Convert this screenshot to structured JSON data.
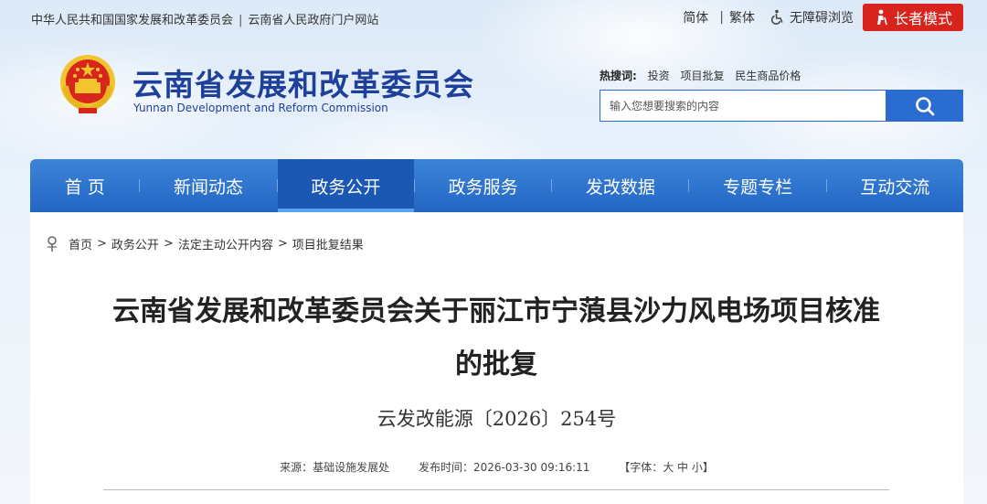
{
  "topbar": {
    "link1": "中华人民共和国国家发展和改革委员会",
    "link2": "云南省人民政府门户网站",
    "separator": "|",
    "simplified": "简体",
    "traditional": "繁体",
    "accessibility": "无障碍浏览",
    "elder_mode": "长者模式"
  },
  "brand": {
    "title": "云南省发展和改革委员会",
    "subtitle": "Yunnan Development and Reform Commission"
  },
  "hot_search": {
    "label": "热搜词:",
    "items": [
      "投资",
      "项目批复",
      "民生商品价格"
    ]
  },
  "search": {
    "placeholder": "输入您想要搜索的内容"
  },
  "nav": {
    "items": [
      {
        "label": "首 页"
      },
      {
        "label": "新闻动态"
      },
      {
        "label": "政务公开"
      },
      {
        "label": "政务服务"
      },
      {
        "label": "发改数据"
      },
      {
        "label": "专题专栏"
      },
      {
        "label": "互动交流"
      }
    ],
    "active_index": 2
  },
  "breadcrumb": {
    "items": [
      "首页",
      "政务公开",
      "法定主动公开内容",
      "项目批复结果"
    ],
    "separator": ">"
  },
  "article": {
    "title_line1": "云南省发展和改革委员会关于丽江市宁蒗县沙力风电场项目核准",
    "title_line2": "的批复",
    "doc_number": "云发改能源〔2026〕254号",
    "source": "来源：基础设施发展处",
    "publish_time": "发布时间：2026-03-30 09:16:11",
    "font_size_control": "【字体：大 中 小】"
  },
  "colors": {
    "brand_blue": "#1e3f9a",
    "nav_blue": "#2a6ccf",
    "elder_red": "#d7251e"
  }
}
